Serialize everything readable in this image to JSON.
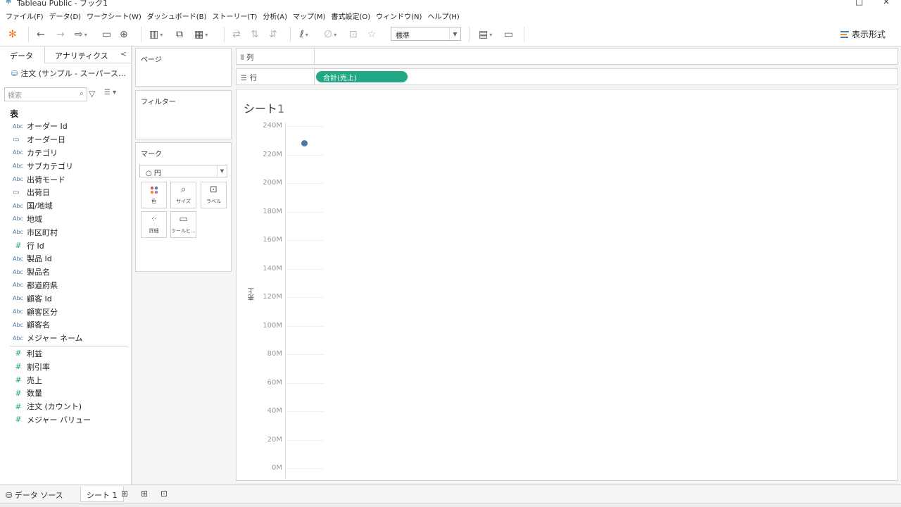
{
  "window": {
    "title": "Tableau Public - ブック1",
    "icon": "tableau-logo-icon",
    "controls": [
      "□",
      "×"
    ]
  },
  "menu": [
    "ファイル(F)",
    "データ(D)",
    "ワークシート(W)",
    "ダッシュボード(B)",
    "ストーリー(T)",
    "分析(A)",
    "マップ(M)",
    "書式設定(O)",
    "ウィンドウ(N)",
    "ヘルプ(H)"
  ],
  "toolbar": {
    "format_select": "標準",
    "show_me_label": "表示形式"
  },
  "data_pane": {
    "tabs": [
      "データ",
      "アナリティクス"
    ],
    "collapse": "<",
    "datasource": "注文 (サンプル - スーパース…",
    "search_placeholder": "検索",
    "section": "表",
    "fields": [
      {
        "type": "Abc",
        "name": "オーダー Id"
      },
      {
        "type": "date",
        "name": "オーダー日"
      },
      {
        "type": "Abc",
        "name": "カテゴリ"
      },
      {
        "type": "Abc",
        "name": "サブカテゴリ"
      },
      {
        "type": "Abc",
        "name": "出荷モード"
      },
      {
        "type": "date",
        "name": "出荷日"
      },
      {
        "type": "Abc",
        "name": "国/地域"
      },
      {
        "type": "Abc",
        "name": "地域"
      },
      {
        "type": "Abc",
        "name": "市区町村"
      },
      {
        "type": "#",
        "name": "行 Id"
      },
      {
        "type": "Abc",
        "name": "製品 Id"
      },
      {
        "type": "Abc",
        "name": "製品名"
      },
      {
        "type": "Abc",
        "name": "都道府県"
      },
      {
        "type": "Abc",
        "name": "顧客 Id"
      },
      {
        "type": "Abc",
        "name": "顧客区分"
      },
      {
        "type": "Abc",
        "name": "顧客名"
      },
      {
        "type": "Abc",
        "name": "メジャー ネーム"
      }
    ],
    "measures": [
      {
        "type": "#",
        "name": "利益"
      },
      {
        "type": "#",
        "name": "割引率"
      },
      {
        "type": "#",
        "name": "売上"
      },
      {
        "type": "#",
        "name": "数量"
      },
      {
        "type": "#",
        "name": "注文 (カウント)"
      },
      {
        "type": "#",
        "name": "メジャー バリュー"
      }
    ]
  },
  "cards": {
    "pages": "ページ",
    "filters": "フィルター",
    "marks": "マーク",
    "marks_type": "○ 円",
    "mark_buttons": [
      {
        "icon": "color-icon",
        "label": "色"
      },
      {
        "icon": "size-icon",
        "label": "サイズ"
      },
      {
        "icon": "label-icon",
        "label": "ラベル"
      },
      {
        "icon": "detail-icon",
        "label": "詳細"
      },
      {
        "icon": "tooltip-icon",
        "label": "ツールヒ…"
      }
    ]
  },
  "shelves": {
    "columns_label": "列",
    "rows_label": "行",
    "rows_pill": "合計(売上)"
  },
  "sheet": {
    "title": "シート",
    "title_num": "1"
  },
  "chart_data": {
    "type": "scatter",
    "ylabel": "売上",
    "yticks": [
      "240M",
      "220M",
      "200M",
      "180M",
      "160M",
      "140M",
      "120M",
      "100M",
      "80M",
      "60M",
      "40M",
      "20M",
      "0M"
    ],
    "ylim": [
      0,
      240
    ],
    "points": [
      {
        "y": 228
      }
    ],
    "color": "#4e79a7"
  },
  "bottom": {
    "datasource_tab": "データ ソース",
    "sheet_tab": "シート 1"
  }
}
